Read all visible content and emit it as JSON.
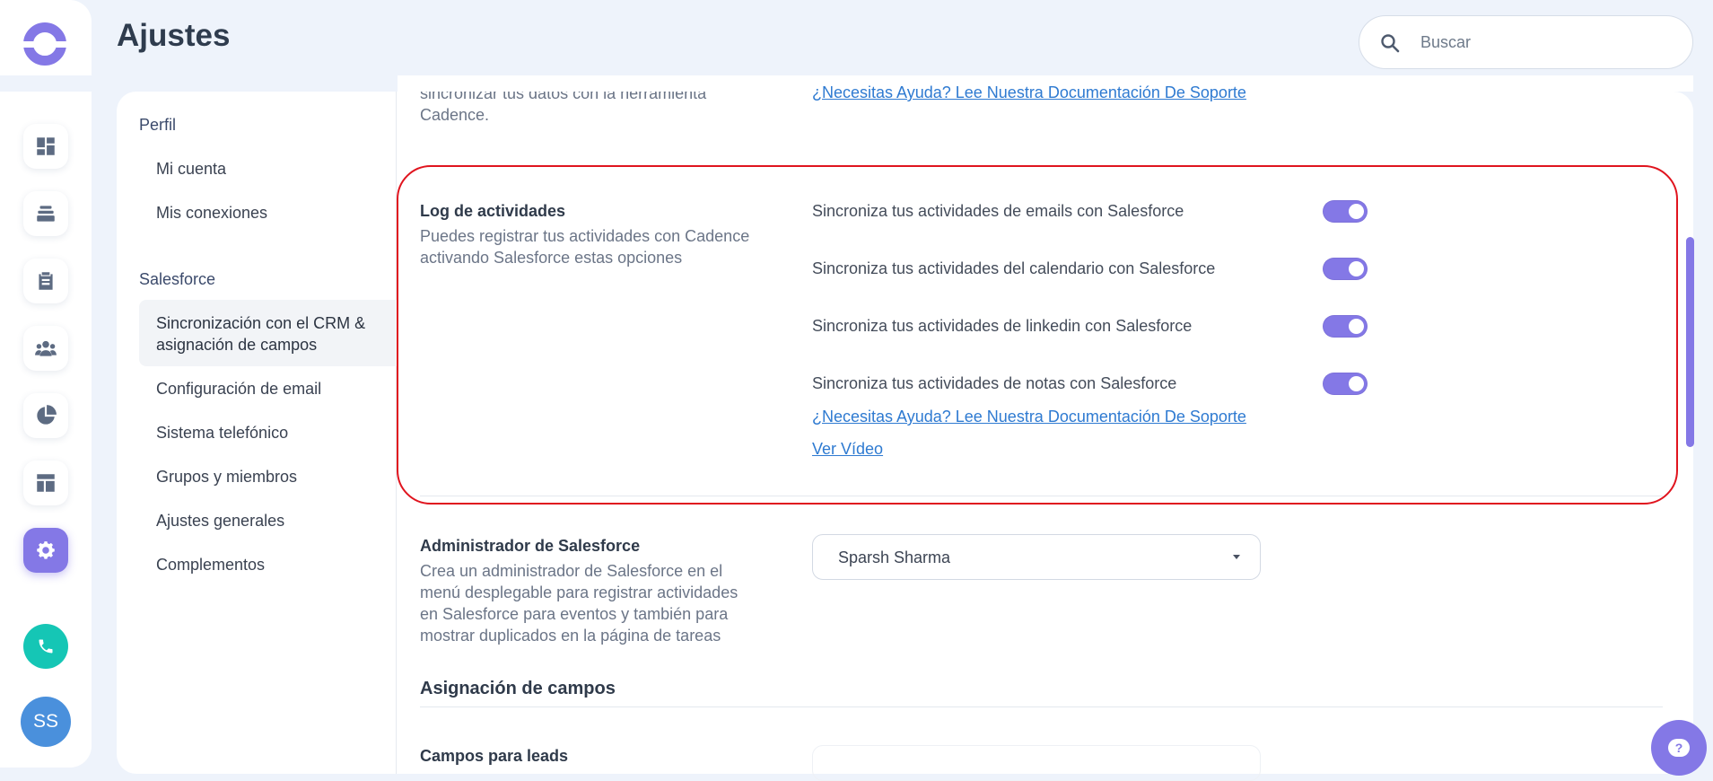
{
  "header": {
    "title": "Ajustes",
    "search_placeholder": "Buscar"
  },
  "rail": {
    "avatar_initials": "SS",
    "icons": [
      "dashboard-icon",
      "layers-icon",
      "tasks-icon",
      "team-icon",
      "chart-icon",
      "layout-icon",
      "settings-icon",
      "phone-icon"
    ],
    "active_icon": "settings-icon"
  },
  "settings_nav": {
    "section1": "Perfil",
    "item_mi_cuenta": "Mi cuenta",
    "item_mis_conexiones": "Mis conexiones",
    "section2": "Salesforce",
    "item_sync_line1": "Sincronización con el CRM &",
    "item_sync_line2": "asignación de campos",
    "item_email": "Configuración de email",
    "item_telefonico": "Sistema telefónico",
    "item_grupos": "Grupos y miembros",
    "item_generales": "Ajustes generales",
    "item_complementos": "Complementos"
  },
  "top_partial": {
    "desc_line1": "sincronizar tus datos con la herramienta",
    "desc_line2": "Cadence.",
    "help_link": "¿Necesitas Ayuda? Lee Nuestra Documentación De Soporte"
  },
  "log": {
    "title": "Log de actividades",
    "desc_line1": "Puedes registrar tus actividades con Cadence",
    "desc_line2": "activando Salesforce estas opciones",
    "row1": "Sincroniza tus actividades de emails con Salesforce",
    "row2": "Sincroniza tus actividades del calendario con Salesforce",
    "row3": "Sincroniza tus actividades de linkedin con Salesforce",
    "row4": "Sincroniza tus actividades de notas con Salesforce",
    "toggles_on": [
      true,
      true,
      true,
      true
    ],
    "help_link": "¿Necesitas Ayuda? Lee Nuestra Documentación De Soporte",
    "video_link": "Ver Vídeo"
  },
  "admin": {
    "title": "Administrador de Salesforce",
    "desc_line1": "Crea un administrador de Salesforce en el",
    "desc_line2": "menú desplegable para registrar actividades",
    "desc_line3": "en Salesforce para eventos y también para",
    "desc_line4": "mostrar duplicados en la página de tareas",
    "selected": "Sparsh Sharma"
  },
  "mapping": {
    "section_title": "Asignación de campos",
    "leads_label": "Campos para leads"
  },
  "colors": {
    "accent": "#8478e6",
    "highlight": "#e0141e",
    "link": "#2e7ad1",
    "phone": "#15c6b5"
  }
}
